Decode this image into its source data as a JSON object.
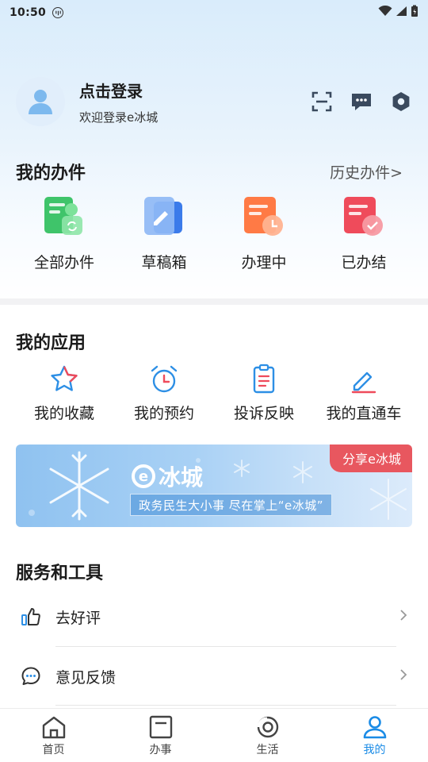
{
  "status_bar": {
    "time": "10:50"
  },
  "profile": {
    "title": "点击登录",
    "subtitle": "欢迎登录e冰城"
  },
  "my_cases": {
    "title": "我的办件",
    "history_link": "历史办件>",
    "items": [
      {
        "label": "全部办件",
        "icon": "all-cases-icon"
      },
      {
        "label": "草稿箱",
        "icon": "drafts-icon"
      },
      {
        "label": "办理中",
        "icon": "in-progress-icon"
      },
      {
        "label": "已办结",
        "icon": "completed-icon"
      }
    ]
  },
  "my_apps": {
    "title": "我的应用",
    "items": [
      {
        "label": "我的收藏",
        "icon": "star-icon"
      },
      {
        "label": "我的预约",
        "icon": "alarm-clock-icon"
      },
      {
        "label": "投诉反映",
        "icon": "clipboard-icon"
      },
      {
        "label": "我的直通车",
        "icon": "edit-icon"
      }
    ]
  },
  "banner": {
    "tag": "分享e冰城",
    "brand": "冰城",
    "brand_e": "e",
    "slogan": "政务民生大小事 尽在掌上“e冰城”"
  },
  "services": {
    "title": "服务和工具",
    "items": [
      {
        "label": "去好评",
        "icon": "thumbs-up-icon"
      },
      {
        "label": "意见反馈",
        "icon": "chat-bubble-icon"
      }
    ]
  },
  "bottom_nav": {
    "items": [
      {
        "label": "首页",
        "icon": "home-icon"
      },
      {
        "label": "办事",
        "icon": "document-icon"
      },
      {
        "label": "生活",
        "icon": "life-icon"
      },
      {
        "label": "我的",
        "icon": "user-icon"
      }
    ],
    "active": "我的"
  },
  "colors": {
    "accent": "#1a8be6",
    "tag_red": "#e8575f",
    "green": "#3fc46a",
    "blue": "#3b7bea",
    "orange": "#ff7a45",
    "red": "#ef4b5b"
  }
}
